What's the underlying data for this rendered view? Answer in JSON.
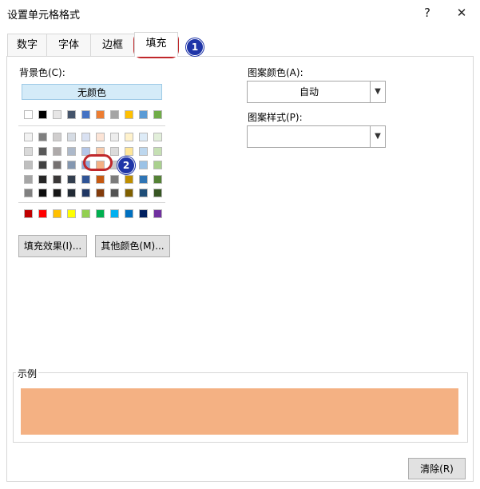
{
  "window": {
    "title": "设置单元格格式",
    "help": "?",
    "close": "✕"
  },
  "tabs": [
    {
      "label": "数字"
    },
    {
      "label": "字体"
    },
    {
      "label": "边框"
    },
    {
      "label": "填充"
    }
  ],
  "fill": {
    "background_label": "背景色(C):",
    "no_color": "无颜色",
    "theme_row": [
      "#ffffff",
      "#000000",
      "#e7e6e6",
      "#44546a",
      "#4472c4",
      "#ed7d31",
      "#a5a5a5",
      "#ffc000",
      "#5b9bd5",
      "#70ad47"
    ],
    "tint_grid": [
      [
        "#f2f2f2",
        "#7f7f7f",
        "#d0cece",
        "#d6dce4",
        "#d9e1f2",
        "#fce4d6",
        "#ededed",
        "#fff2cc",
        "#ddebf7",
        "#e2efda"
      ],
      [
        "#d9d9d9",
        "#595959",
        "#aeaaaa",
        "#adb9ca",
        "#b4c6e7",
        "#f8cbad",
        "#dbdbdb",
        "#ffe699",
        "#bdd7ee",
        "#c6e0b4"
      ],
      [
        "#bfbfbf",
        "#404040",
        "#757171",
        "#8497b0",
        "#8ea9db",
        "#f4b084",
        "#c9c9c9",
        "#ffd966",
        "#9bc2e6",
        "#a9d08e"
      ],
      [
        "#a6a6a6",
        "#262626",
        "#3a3838",
        "#333f4f",
        "#305496",
        "#c65911",
        "#7b7b7b",
        "#bf8f00",
        "#2f75b5",
        "#548235"
      ],
      [
        "#808080",
        "#0d0d0d",
        "#161616",
        "#222b35",
        "#203764",
        "#833c0c",
        "#525252",
        "#806000",
        "#1f4e78",
        "#375623"
      ]
    ],
    "standard_row": [
      "#c00000",
      "#ff0000",
      "#ffc000",
      "#ffff00",
      "#92d050",
      "#00b050",
      "#00b0f0",
      "#0070c0",
      "#002060",
      "#7030a0"
    ],
    "fill_effects_button": "填充效果(I)...",
    "more_colors_button": "其他颜色(M)...",
    "pattern_color_label": "图案颜色(A):",
    "pattern_color_value": "自动",
    "pattern_style_label": "图案样式(P):",
    "pattern_style_value": "",
    "sample_label": "示例",
    "sample_color": "#f4b183",
    "clear_button": "清除(R)"
  },
  "annotations": {
    "badge1": "1",
    "badge2": "2"
  }
}
